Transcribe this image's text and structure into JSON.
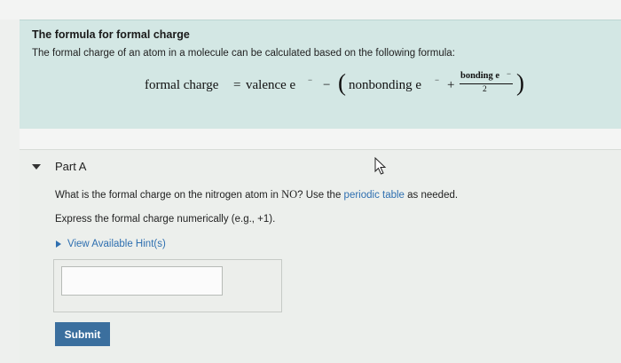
{
  "intro": {
    "title": "The formula for formal charge",
    "description": "The formal charge of an atom in a molecule can be calculated based on the following formula:",
    "formula": {
      "lhs": "formal charge",
      "equals": "=",
      "valence": "valence e",
      "minus": "−",
      "open_paren": "(",
      "nonbonding": "nonbonding e",
      "plus": "+",
      "frac_numerator": "bonding e",
      "frac_denominator": "2",
      "close_paren": ")",
      "electron_sup": "−"
    }
  },
  "part": {
    "title": "Part A",
    "question_prefix": "What is the formal charge on the nitrogen atom in ",
    "question_molecule": "NO",
    "question_mid": "? Use the ",
    "periodic_link": "periodic table",
    "question_suffix": " as needed.",
    "instruction": "Express the formal charge numerically (e.g., +1).",
    "hint_label": "View Available Hint(s)",
    "answer_value": "",
    "submit_label": "Submit"
  }
}
